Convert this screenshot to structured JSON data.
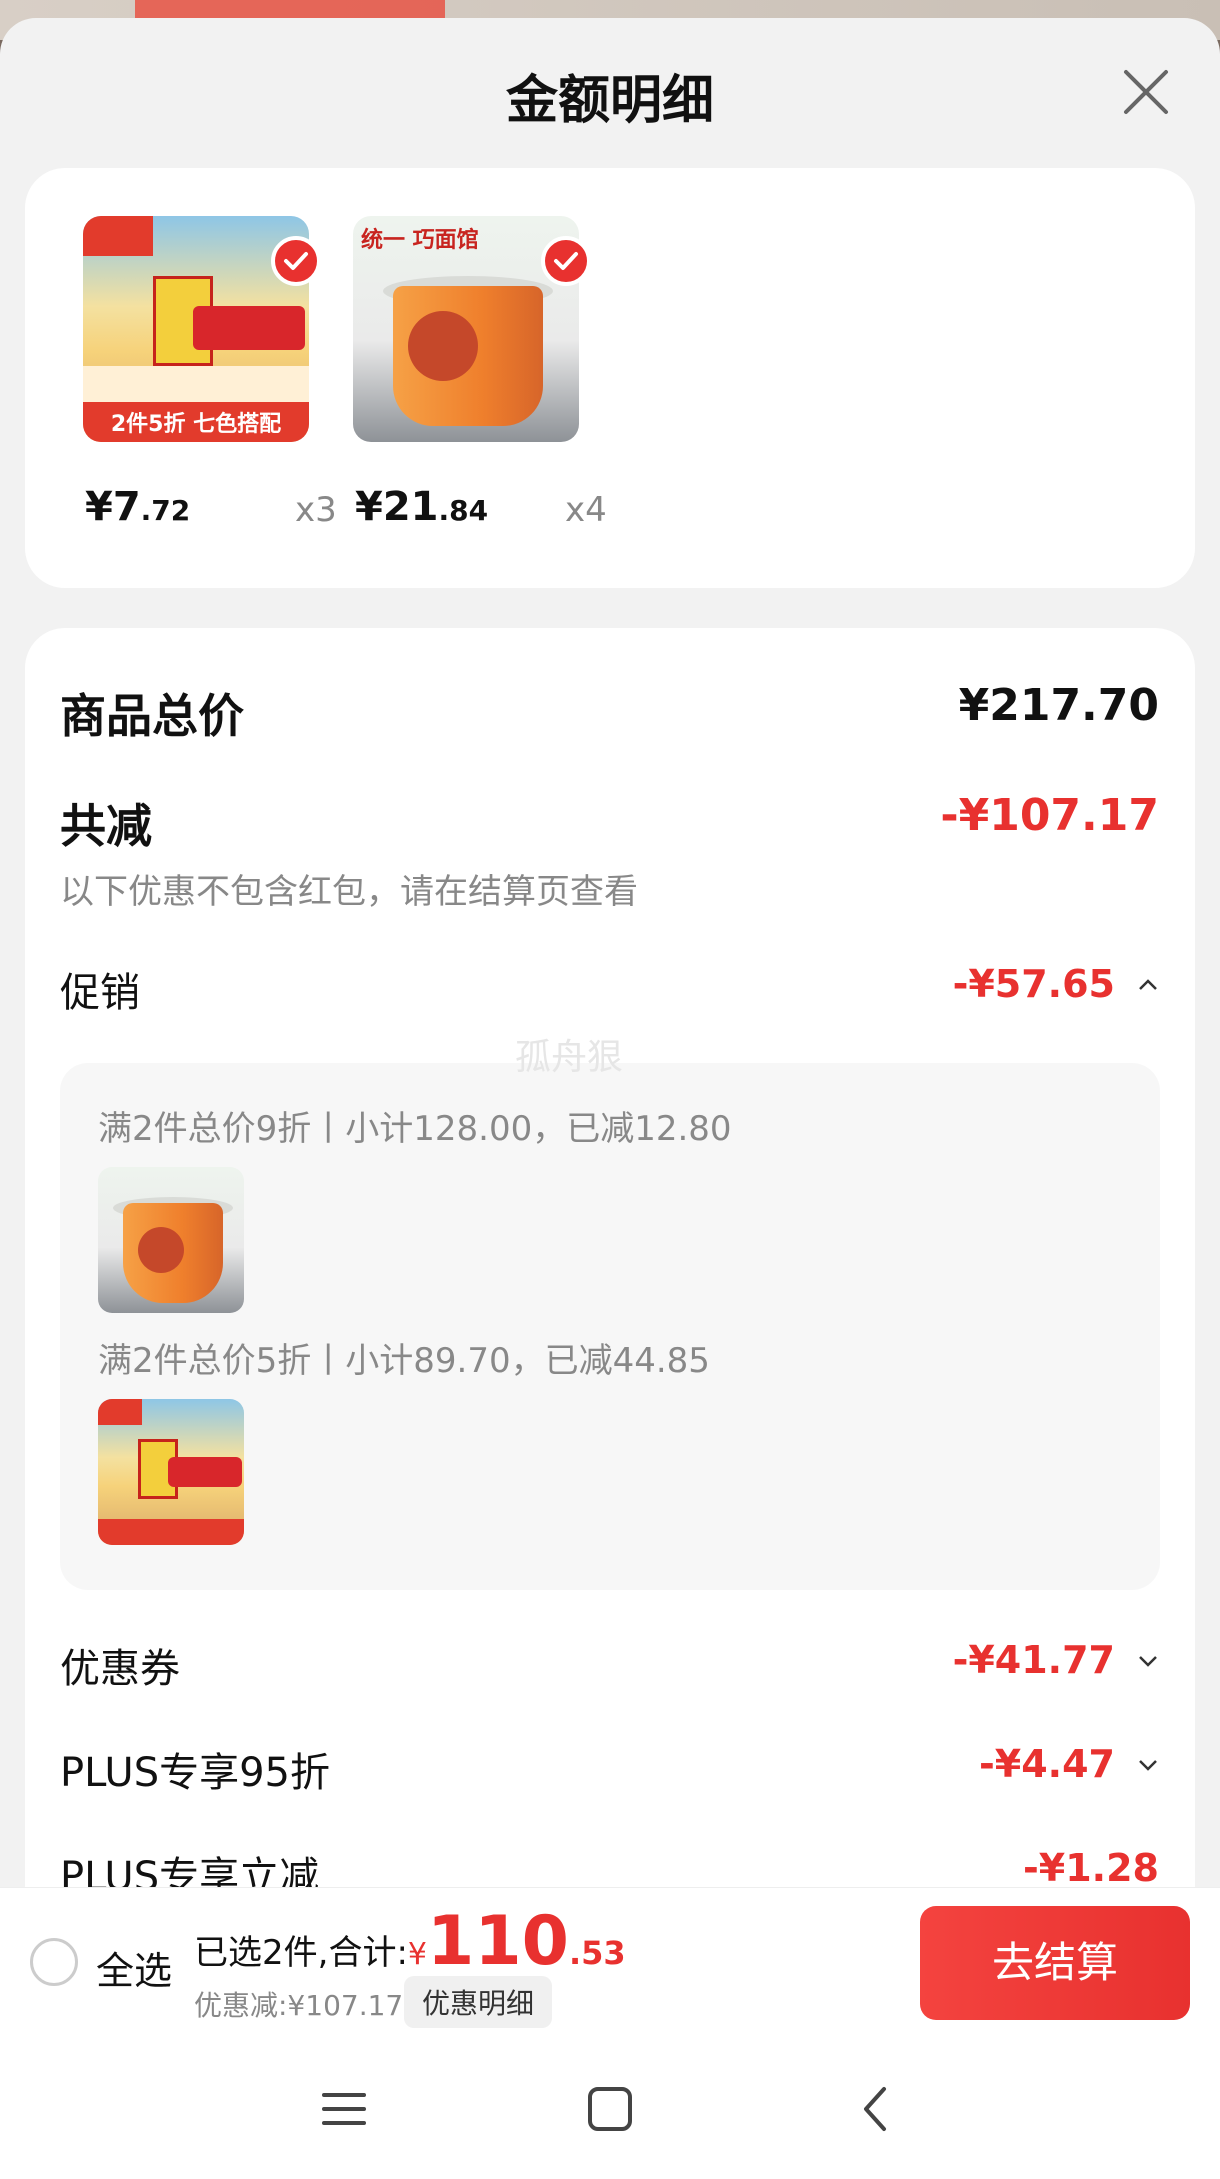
{
  "sheet": {
    "title": "金额明细"
  },
  "products": [
    {
      "price_int": "¥7",
      "price_dec": ".72",
      "qty": "x3",
      "thumb_banner": "2件5折 七色搭配"
    },
    {
      "price_int": "¥21",
      "price_dec": ".84",
      "qty": "x4",
      "thumb_brand": "统一 巧面馆"
    }
  ],
  "details": {
    "total_label": "商品总价",
    "total_value": "¥217.70",
    "reduce_label": "共减",
    "reduce_value": "-¥107.17",
    "reduce_note": "以下优惠不包含红包，请在结算页查看",
    "promo_label": "促销",
    "promo_value": "-¥57.65",
    "promo_items": [
      {
        "text": "满2件总价9折丨小计128.00，已减12.80"
      },
      {
        "text": "满2件总价5折丨小计89.70，已减44.85"
      }
    ],
    "coupon_label": "优惠券",
    "coupon_value": "-¥41.77",
    "plus95_label": "PLUS专享95折",
    "plus95_value": "-¥4.47",
    "plusreduce_label": "PLUS专享立减",
    "plusreduce_value": "-¥1.28"
  },
  "watermark": "孤舟狠",
  "bottom": {
    "select_all": "全选",
    "selected_text": "已选2件,合计:",
    "yen": "¥",
    "total_int": "110",
    "total_dec": ".53",
    "saved_text": "优惠减:¥107.17",
    "detail_pill": "优惠明细",
    "checkout": "去结算"
  },
  "icons": [
    "close-icon",
    "check-icon",
    "chevron-up-icon",
    "chevron-down-icon",
    "menu-icon",
    "home-icon",
    "back-icon"
  ],
  "colors": {
    "accent_red": "#e8312f",
    "muted_gray": "#888888"
  }
}
